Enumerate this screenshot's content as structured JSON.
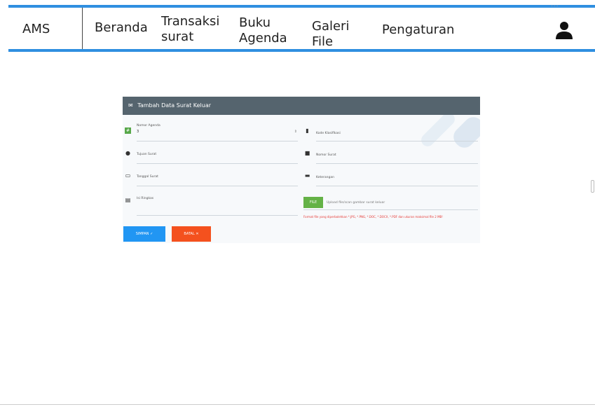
{
  "navbar": {
    "brand": "AMS",
    "items": [
      {
        "label_line1": "Beranda",
        "label_line2": ""
      },
      {
        "label_line1": "Transaksi",
        "label_line2": "surat"
      },
      {
        "label_line1": "Buku",
        "label_line2": "Agenda"
      },
      {
        "label_line1": "Galeri",
        "label_line2": "File"
      },
      {
        "label_line1": "Pengaturan",
        "label_line2": ""
      }
    ],
    "dots": "...",
    "accent_color": "#2f8fe0"
  },
  "form": {
    "title": "Tambah Data Surat Keluar",
    "header_color": "#55646e",
    "fields": {
      "nomor_agenda": {
        "label": "Nomor Agenda",
        "value": "3"
      },
      "kode_klasifikasi": {
        "label": "Kode Klasifikasi"
      },
      "tujuan_surat": {
        "label": "Tujuan Surat"
      },
      "nomor_surat": {
        "label": "Nomor Surat"
      },
      "tanggal_surat": {
        "label": "Tanggal Surat"
      },
      "keterangan": {
        "label": "Keterangan"
      },
      "isi_ringkas": {
        "label": "Isi Ringkas"
      }
    },
    "file": {
      "button_label": "FILE",
      "placeholder": "Upload file/scan gambar surat keluar",
      "note": "Format file yang diperbolehkan *.JPG, *.PNG, *.DOC, *.DOCX, *.PDF dan ukuran maksimal file 2 MB!"
    },
    "buttons": {
      "save_label": "SIMPAN",
      "cancel_label": "BATAL"
    }
  }
}
